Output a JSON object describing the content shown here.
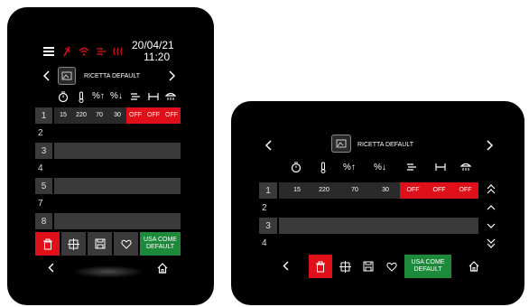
{
  "colors": {
    "bg": "#000000",
    "accent_red": "#e01018",
    "green": "#1c8a3a",
    "row_grey": "#3a3a3a"
  },
  "status": {
    "date": "20/04/21",
    "time": "11:20"
  },
  "header": {
    "recipe_name": "RICETTA DEFAULT"
  },
  "columns": [
    {
      "icon": "timer-icon"
    },
    {
      "icon": "thermometer-icon"
    },
    {
      "icon": "humidity-up-icon",
      "label": "%↑"
    },
    {
      "icon": "humidity-down-icon",
      "label": "%↓"
    },
    {
      "icon": "fan-icon"
    },
    {
      "icon": "interval-icon"
    },
    {
      "icon": "shower-icon"
    }
  ],
  "steps": [
    {
      "n": "1",
      "values": [
        "15",
        "220",
        "70",
        "30",
        "OFF",
        "OFF",
        "OFF"
      ]
    },
    {
      "n": "2"
    },
    {
      "n": "3"
    },
    {
      "n": "4"
    },
    {
      "n": "5"
    },
    {
      "n": "7"
    },
    {
      "n": "8"
    }
  ],
  "steps_landscape": [
    "1",
    "2",
    "3",
    "4"
  ],
  "buttons": {
    "use_default": "USA COME DEFAULT",
    "use_default_l1": "USA COME",
    "use_default_l2": "DEFAULT"
  }
}
